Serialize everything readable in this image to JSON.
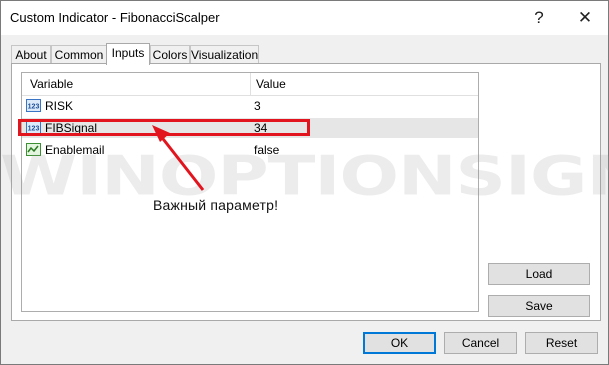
{
  "window": {
    "title": "Custom Indicator - FibonacciScalper",
    "help_glyph": "?",
    "close_glyph": "✕"
  },
  "tabs": [
    {
      "label": "About",
      "active": false
    },
    {
      "label": "Common",
      "active": false
    },
    {
      "label": "Inputs",
      "active": true
    },
    {
      "label": "Colors",
      "active": false
    },
    {
      "label": "Visualization",
      "active": false
    }
  ],
  "grid": {
    "columns": [
      "Variable",
      "Value"
    ],
    "rows": [
      {
        "icon": "integer-123-icon",
        "name": "RISK",
        "value": "3"
      },
      {
        "icon": "integer-123-icon",
        "name": "FIBSignal",
        "value": "34",
        "selected": true
      },
      {
        "icon": "boolean-toggle-icon",
        "name": "Enablemail",
        "value": "false"
      }
    ]
  },
  "annotation": {
    "text": "Важный параметр!",
    "color": "#e2141e"
  },
  "watermark": "WINOPTIONSIGNALS.COM",
  "side_buttons": {
    "load": "Load",
    "save": "Save"
  },
  "footer_buttons": {
    "ok": "OK",
    "cancel": "Cancel",
    "reset": "Reset"
  }
}
